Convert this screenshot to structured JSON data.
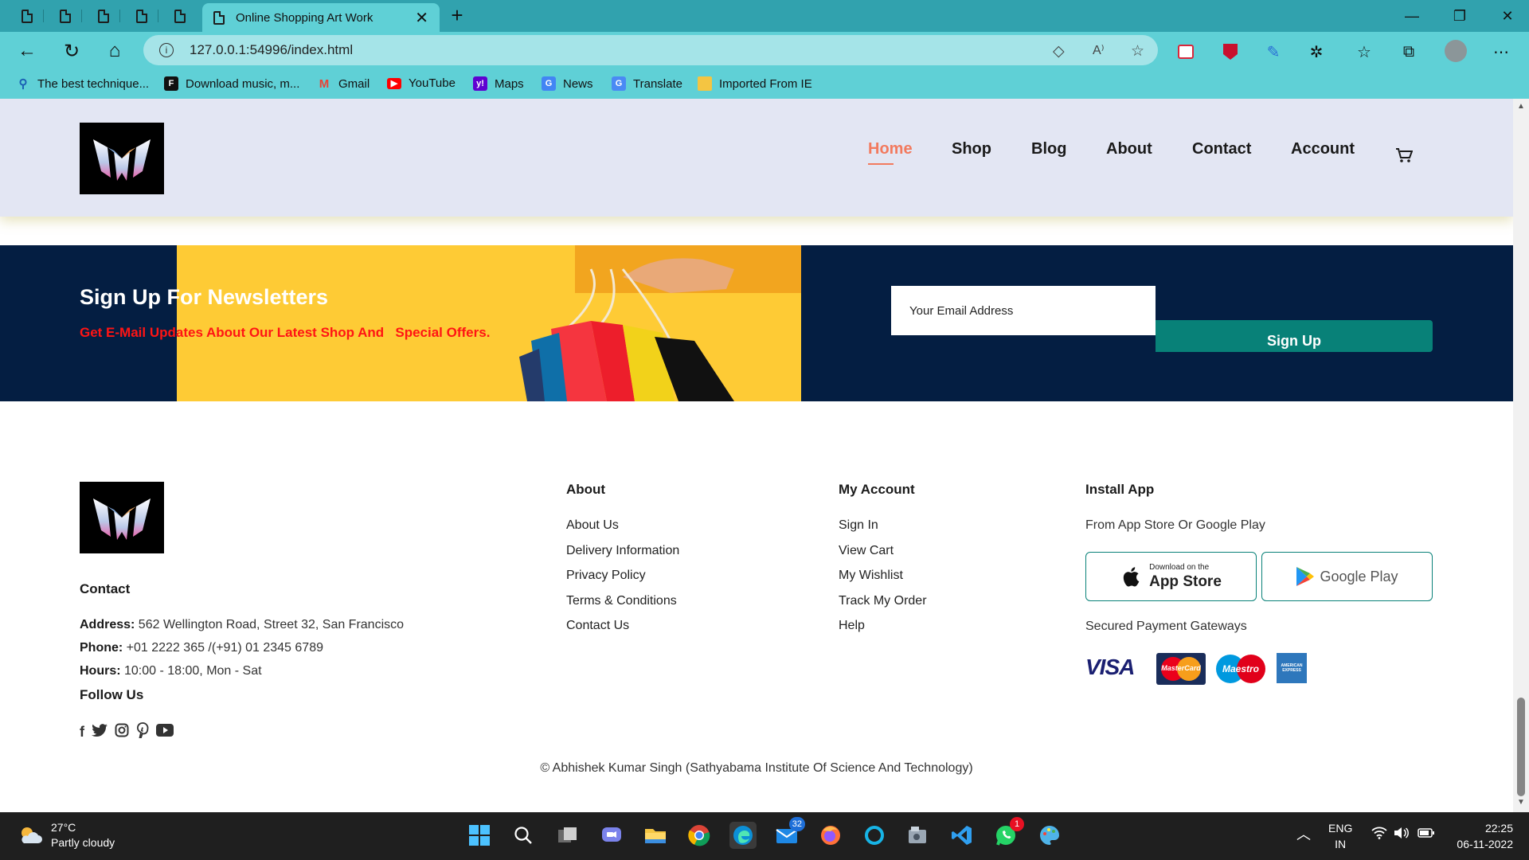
{
  "browser": {
    "active_tab_title": "Online Shopping Art Work",
    "tab_close": "✕",
    "new_tab": "+",
    "url": "127.0.0.1:54996/index.html",
    "bookmarks": [
      {
        "label": "The best technique...",
        "icon": "search-icon"
      },
      {
        "label": "Download music, m...",
        "icon": "f-logo-icon"
      },
      {
        "label": "Gmail",
        "icon": "gmail-icon"
      },
      {
        "label": "YouTube",
        "icon": "youtube-icon"
      },
      {
        "label": "Maps",
        "icon": "yahoo-icon"
      },
      {
        "label": "News",
        "icon": "news-icon"
      },
      {
        "label": "Translate",
        "icon": "translate-icon"
      },
      {
        "label": "Imported From IE",
        "icon": "folder-icon"
      }
    ]
  },
  "header": {
    "nav": [
      "Home",
      "Shop",
      "Blog",
      "About",
      "Contact",
      "Account"
    ],
    "active": "Home"
  },
  "newsletter": {
    "title": "Sign Up For Newsletters",
    "subtitle": "Get E-Mail Updates About Our Latest Shop And   Special Offers.",
    "email_placeholder": "Your Email Address",
    "button": "Sign Up"
  },
  "footer": {
    "contact_heading": "Contact",
    "address_label": "Address:",
    "address": " 562 Wellington Road, Street 32, San Francisco",
    "phone_label": "Phone:",
    "phone": " +01 2222 365 /(+91) 01 2345 6789",
    "hours_label": "Hours:",
    "hours": " 10:00 - 18:00, Mon - Sat",
    "follow_heading": "Follow Us",
    "social": [
      "facebook-icon",
      "twitter-icon",
      "instagram-icon",
      "pinterest-icon",
      "youtube-icon"
    ],
    "about_heading": "About",
    "about_links": [
      "About Us",
      "Delivery Information",
      "Privacy Policy",
      "Terms & Conditions",
      "Contact Us"
    ],
    "account_heading": "My Account",
    "account_links": [
      "Sign In",
      "View Cart",
      "My Wishlist",
      "Track My Order",
      "Help"
    ],
    "install_heading": "Install App",
    "install_sub": "From App Store Or Google Play",
    "app_store_small": "Download on the",
    "app_store_big": "App Store",
    "google_play": "Google Play",
    "payments_heading": "Secured Payment Gateways",
    "payments": [
      "VISA",
      "MasterCard",
      "Maestro",
      "AMERICAN EXPRESS"
    ],
    "copyright": "© Abhishek Kumar Singh (Sathyabama Institute Of Science And Technology)"
  },
  "taskbar": {
    "temperature": "27°C",
    "weather": "Partly cloudy",
    "mail_badge": "32",
    "whatsapp_badge": "1",
    "lang_top": "ENG",
    "lang_bottom": "IN",
    "time": "22:25",
    "date": "06-11-2022"
  },
  "colors": {
    "accent": "#088178",
    "active_nav": "#f27a5e",
    "newsletter_bg": "#041e42",
    "newsletter_subtitle": "#ff1414",
    "header_bg": "#e3e6f3",
    "browser_tab": "#31a2ae",
    "browser_toolbar": "#5fd0d6"
  }
}
